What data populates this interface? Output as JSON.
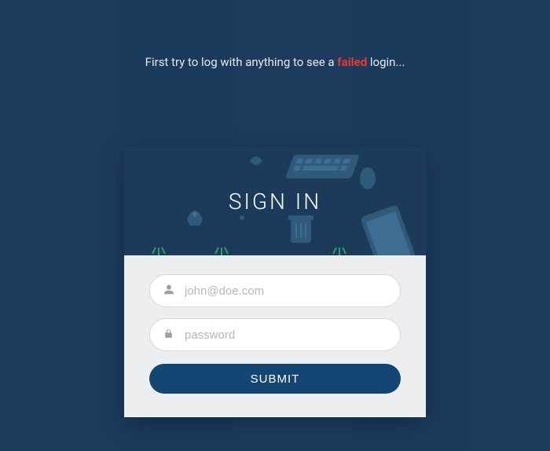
{
  "hint": {
    "prefix": "First try to log with anything to see a ",
    "highlight": "failed",
    "suffix": " login..."
  },
  "card": {
    "title": "SIGN IN",
    "email_placeholder": "john@doe.com",
    "password_placeholder": "password",
    "submit_label": "SUBMIT"
  },
  "icons": {
    "user": "user-icon",
    "lock": "lock-icon"
  },
  "colors": {
    "background": "#1a3a5c",
    "card_header": "#1c3a5a",
    "card_body": "#eceeef",
    "button": "#134672",
    "failed_text": "#e53935"
  }
}
